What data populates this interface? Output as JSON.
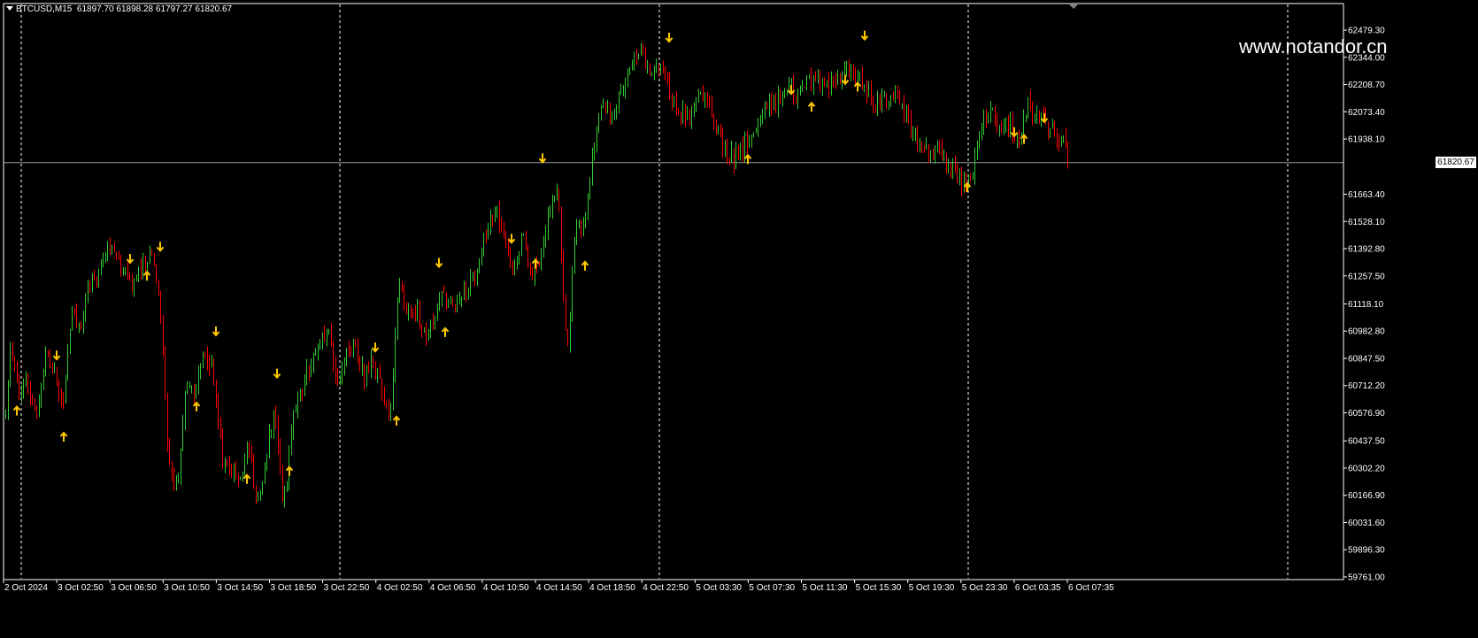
{
  "header": {
    "symbol": "BTCUSD,M15",
    "ohlc": "61897.70 61898.28 61797.27 61820.67"
  },
  "watermark": "www.notandor.cn",
  "current_price_label": "61820.67",
  "colors": {
    "background": "#000000",
    "bull": "#32cd32",
    "bear": "#ff0000",
    "grid": "#ffffff",
    "arrow": "#ffc800",
    "price_line": "#9e9e9e",
    "text": "#ffffff"
  },
  "chart_data": {
    "type": "candlestick",
    "ylim": [
      59761.0,
      62600.0
    ],
    "current_price": 61820.67,
    "y_ticks": [
      62479.3,
      62344.0,
      62208.7,
      62073.4,
      61938.1,
      61663.4,
      61528.1,
      61392.8,
      61257.5,
      61118.1,
      60982.8,
      60847.5,
      60712.2,
      60576.9,
      60437.5,
      60302.2,
      60166.9,
      60031.6,
      59896.3,
      59761.0
    ],
    "y_tick_labels": [
      "62479.30",
      "62344.00",
      "62208.70",
      "62073.40",
      "61938.10",
      "61663.40",
      "61528.10",
      "61392.80",
      "61257.50",
      "61118.10",
      "60982.80",
      "60847.50",
      "60712.20",
      "60576.90",
      "60437.50",
      "60302.20",
      "60166.90",
      "60031.60",
      "59896.30",
      "59761.00"
    ],
    "x_labels": [
      "2 Oct 2024",
      "3 Oct 02:50",
      "3 Oct 06:50",
      "3 Oct 10:50",
      "3 Oct 14:50",
      "3 Oct 18:50",
      "3 Oct 22:50",
      "4 Oct 02:50",
      "4 Oct 06:50",
      "4 Oct 10:50",
      "4 Oct 14:50",
      "4 Oct 18:50",
      "4 Oct 22:50",
      "5 Oct 03:30",
      "5 Oct 07:30",
      "5 Oct 11:30",
      "5 Oct 15:30",
      "5 Oct 19:30",
      "5 Oct 23:30",
      "6 Oct 03:35",
      "6 Oct 07:35"
    ],
    "day_separators": [
      "3 Oct 00:00",
      "4 Oct 00:00",
      "5 Oct 00:00",
      "6 Oct 00:00",
      "6 Oct 12:00"
    ],
    "grid": false,
    "price_path": [
      [
        0,
        60050
      ],
      [
        10,
        60900
      ],
      [
        20,
        60700
      ],
      [
        30,
        60750
      ],
      [
        40,
        60550
      ],
      [
        50,
        60850
      ],
      [
        60,
        60800
      ],
      [
        70,
        60600
      ],
      [
        80,
        61100
      ],
      [
        90,
        61000
      ],
      [
        100,
        61200
      ],
      [
        110,
        61250
      ],
      [
        120,
        61400
      ],
      [
        130,
        61350
      ],
      [
        140,
        61250
      ],
      [
        150,
        61200
      ],
      [
        160,
        61300
      ],
      [
        170,
        61350
      ],
      [
        180,
        61150
      ],
      [
        190,
        60300
      ],
      [
        200,
        60200
      ],
      [
        210,
        60750
      ],
      [
        220,
        60650
      ],
      [
        230,
        60900
      ],
      [
        240,
        60800
      ],
      [
        250,
        60350
      ],
      [
        260,
        60300
      ],
      [
        270,
        60200
      ],
      [
        280,
        60450
      ],
      [
        290,
        60100
      ],
      [
        300,
        60350
      ],
      [
        310,
        60600
      ],
      [
        320,
        60100
      ],
      [
        330,
        60550
      ],
      [
        340,
        60700
      ],
      [
        350,
        60800
      ],
      [
        360,
        60900
      ],
      [
        370,
        61000
      ],
      [
        380,
        60750
      ],
      [
        390,
        60850
      ],
      [
        400,
        60900
      ],
      [
        410,
        60750
      ],
      [
        420,
        60850
      ],
      [
        430,
        60700
      ],
      [
        440,
        60550
      ],
      [
        450,
        61200
      ],
      [
        460,
        61050
      ],
      [
        470,
        61100
      ],
      [
        480,
        60950
      ],
      [
        490,
        61050
      ],
      [
        500,
        61150
      ],
      [
        510,
        61100
      ],
      [
        520,
        61150
      ],
      [
        530,
        61200
      ],
      [
        540,
        61300
      ],
      [
        550,
        61500
      ],
      [
        560,
        61600
      ],
      [
        570,
        61400
      ],
      [
        580,
        61300
      ],
      [
        590,
        61450
      ],
      [
        600,
        61250
      ],
      [
        610,
        61350
      ],
      [
        620,
        61600
      ],
      [
        630,
        61650
      ],
      [
        640,
        60850
      ],
      [
        650,
        61500
      ],
      [
        660,
        61500
      ],
      [
        670,
        61900
      ],
      [
        680,
        62100
      ],
      [
        690,
        62050
      ],
      [
        700,
        62150
      ],
      [
        710,
        62300
      ],
      [
        720,
        62400
      ],
      [
        730,
        62300
      ],
      [
        740,
        62300
      ],
      [
        750,
        62250
      ],
      [
        760,
        62100
      ],
      [
        770,
        62050
      ],
      [
        780,
        62050
      ],
      [
        790,
        62150
      ],
      [
        800,
        62100
      ],
      [
        810,
        62000
      ],
      [
        820,
        61850
      ],
      [
        830,
        61850
      ],
      [
        840,
        61900
      ],
      [
        850,
        62000
      ],
      [
        860,
        62050
      ],
      [
        870,
        62100
      ],
      [
        880,
        62150
      ],
      [
        890,
        62200
      ],
      [
        900,
        62150
      ],
      [
        910,
        62200
      ],
      [
        920,
        62250
      ],
      [
        930,
        62200
      ],
      [
        940,
        62200
      ],
      [
        950,
        62250
      ],
      [
        960,
        62300
      ],
      [
        970,
        62250
      ],
      [
        980,
        62150
      ],
      [
        990,
        62100
      ],
      [
        1000,
        62150
      ],
      [
        1010,
        62150
      ],
      [
        1020,
        62100
      ],
      [
        1030,
        61950
      ],
      [
        1040,
        61900
      ],
      [
        1050,
        61850
      ],
      [
        1060,
        61900
      ],
      [
        1070,
        61800
      ],
      [
        1080,
        61750
      ],
      [
        1090,
        61700
      ],
      [
        1100,
        61800
      ],
      [
        1110,
        62050
      ],
      [
        1120,
        62050
      ],
      [
        1130,
        62000
      ],
      [
        1140,
        62000
      ],
      [
        1150,
        61950
      ],
      [
        1160,
        62100
      ],
      [
        1170,
        62050
      ],
      [
        1180,
        62000
      ],
      [
        1190,
        61950
      ],
      [
        1200,
        61950
      ],
      [
        1208,
        61820
      ]
    ],
    "arrows_down": [
      [
        64,
        60860
      ],
      [
        147,
        61340
      ],
      [
        181,
        61400
      ],
      [
        244,
        60980
      ],
      [
        313,
        60770
      ],
      [
        424,
        60900
      ],
      [
        496,
        61320
      ],
      [
        578,
        61440
      ],
      [
        613,
        61840
      ],
      [
        756,
        62440
      ],
      [
        894,
        62180
      ],
      [
        955,
        62230
      ],
      [
        977,
        62450
      ],
      [
        1146,
        61970
      ],
      [
        1180,
        62040
      ]
    ],
    "arrows_up": [
      [
        19,
        60590
      ],
      [
        72,
        60460
      ],
      [
        166,
        61260
      ],
      [
        222,
        60610
      ],
      [
        279,
        60250
      ],
      [
        327,
        60290
      ],
      [
        448,
        60540
      ],
      [
        503,
        60980
      ],
      [
        605,
        61320
      ],
      [
        661,
        61310
      ],
      [
        845,
        61840
      ],
      [
        917,
        62100
      ],
      [
        969,
        62200
      ],
      [
        1093,
        61700
      ],
      [
        1157,
        61940
      ]
    ]
  }
}
